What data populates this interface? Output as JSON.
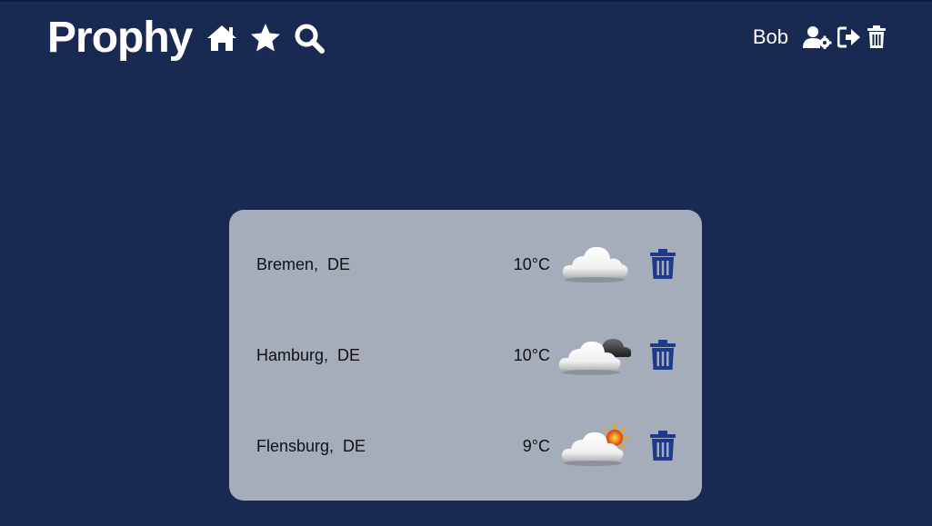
{
  "app": {
    "brand": "Prophy"
  },
  "nav": {
    "items": [
      {
        "name": "home-icon"
      },
      {
        "name": "star-icon"
      },
      {
        "name": "search-icon"
      }
    ]
  },
  "user": {
    "name": "Bob",
    "icons": [
      "user-settings-icon",
      "logout-icon",
      "delete-account-icon"
    ]
  },
  "locations": [
    {
      "city": "Bremen,  DE",
      "temp": "10°C",
      "weather_icon": "cloudy-icon"
    },
    {
      "city": "Hamburg,  DE",
      "temp": "10°C",
      "weather_icon": "cloudy-dark-icon"
    },
    {
      "city": "Flensburg,  DE",
      "temp": "9°C",
      "weather_icon": "partly-sunny-icon"
    }
  ],
  "colors": {
    "background": "#182952",
    "card": "#a5acba",
    "accent": "#1e3a8a",
    "text": "#111111"
  }
}
